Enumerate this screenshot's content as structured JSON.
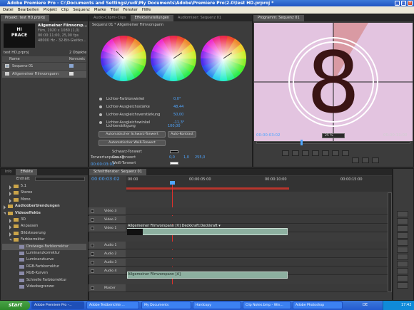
{
  "window": {
    "title": "Adobe Premiere Pro - C:\\Documents and Settings\\rudi\\My Documents\\Adobe\\Premiere Pro\\2.0\\test HD.prproj *"
  },
  "menu": [
    "Datei",
    "Bearbeiten",
    "Projekt",
    "Clip",
    "Sequenz",
    "Marke",
    "Titel",
    "Fenster",
    "Hilfe"
  ],
  "project": {
    "tab": "Projekt: test HD.prproj",
    "thumb_text": "HI\nPRACE",
    "clip_name": "Allgemeiner Filmvorsp...",
    "clip_info": [
      "Film, 1920 x 1080 (1,0)",
      "00:00:11:00, 25,00 fps",
      "48000 Hz - 32-Bit-Gleitko..."
    ],
    "file": "test HD.prproj",
    "count": "2 Objekte",
    "col_name": "Name",
    "col_label": "Kennzeic",
    "items": [
      "Sequenz 01",
      "Allgemeiner Filmvorspann"
    ]
  },
  "effect_controls": {
    "tabs": [
      "Audio-Clipmi-Clips",
      "Effekteinstellungen",
      "Audiomixer: Sequenz 01"
    ],
    "header": "Sequenz 01 * Allgemeiner Filmvorspann",
    "params": [
      {
        "label": "Lichter-Farbtonwinkel",
        "value": "0,0°"
      },
      {
        "label": "Lichter-Ausgleichsstärke",
        "value": "48,44"
      },
      {
        "label": "Lichter-Ausgleichsverstärkung",
        "value": "50,00"
      },
      {
        "label": "Lichter-Ausgleichswinkel",
        "value": "-11,3°"
      }
    ],
    "saturation_label": "Lichtersättigung",
    "saturation_value": "100,00",
    "buttons": {
      "auto_black": "Automatischer Schwarz-Tonwert",
      "auto_contrast": "Auto-Kontrast",
      "auto_white": "Automatischer Weiß-Tonwert"
    },
    "levels": [
      "Schwarz-Tonwert",
      "Grau-Tonwert",
      "Weiß-Tonwert"
    ],
    "tonal_label": "Tonwertanpassung",
    "tonal_values": [
      "0,0",
      "1,0",
      "255,0"
    ],
    "timecode": "00:00:03:02"
  },
  "program": {
    "tab": "Programm: Sequenz 01",
    "countdown": "8",
    "timecode": "00:00:03:02",
    "zoom": "25 %",
    "duration": "00:00:11:00"
  },
  "effects": {
    "tabs": [
      "Info",
      "Effekte"
    ],
    "search_label": "Enthält:",
    "items": [
      {
        "label": "5.1",
        "indent": 1,
        "open": false
      },
      {
        "label": "Stereo",
        "indent": 1,
        "open": false
      },
      {
        "label": "Mono",
        "indent": 1,
        "open": false
      },
      {
        "label": "Audioüberblendungen",
        "indent": 0,
        "open": false,
        "bold": true
      },
      {
        "label": "Videoeffekte",
        "indent": 0,
        "open": true,
        "bold": true
      },
      {
        "label": "3D",
        "indent": 1,
        "open": false
      },
      {
        "label": "Anpassen",
        "indent": 1,
        "open": false
      },
      {
        "label": "Bildsteuerung",
        "indent": 1,
        "open": false
      },
      {
        "label": "Farbkorrektur",
        "indent": 1,
        "open": true
      },
      {
        "label": "Dreiwege-Farbkorrektur",
        "indent": 2,
        "selected": true
      },
      {
        "label": "Luminanzkorrektur",
        "indent": 2
      },
      {
        "label": "Luminanzkurve",
        "indent": 2
      },
      {
        "label": "RGB-Farbkorrektur",
        "indent": 2
      },
      {
        "label": "RGB-Kurven",
        "indent": 2
      },
      {
        "label": "Schnelle Farbkorrektur",
        "indent": 2
      },
      {
        "label": "Videobegrenzer",
        "indent": 2
      }
    ]
  },
  "timeline": {
    "tab": "Schnittfenster: Sequenz 01",
    "timecode": "00:00:03:02",
    "ruler": [
      "00:00",
      "00:00:05:00",
      "00:00:10:00",
      "00:00:15:00"
    ],
    "tracks": [
      "Video 3",
      "Video 2",
      "Video 1",
      "Audio 1",
      "Audio 2",
      "Audio 3",
      "Audio 4",
      "Master"
    ],
    "video_clip": "Allgemeiner Filmvorspann [V]  Deckkraft:Deckkraft ▾",
    "audio_clip": "Allgemeiner Filmvorspann [A]"
  },
  "taskbar": {
    "start": "start",
    "items": [
      "Adobe Premiere Pro -...",
      "Adobe Testberichte....",
      "My Documents",
      "Hardcopy",
      "Clip Notes.bmp - Win...",
      "Adobe Photoshop"
    ],
    "lang": "DE",
    "clock": "17:42"
  },
  "colors": {
    "accent_blue": "#4fa6ff",
    "clip_green": "#8db0a0",
    "countdown_bg": "#e3c4e0"
  }
}
